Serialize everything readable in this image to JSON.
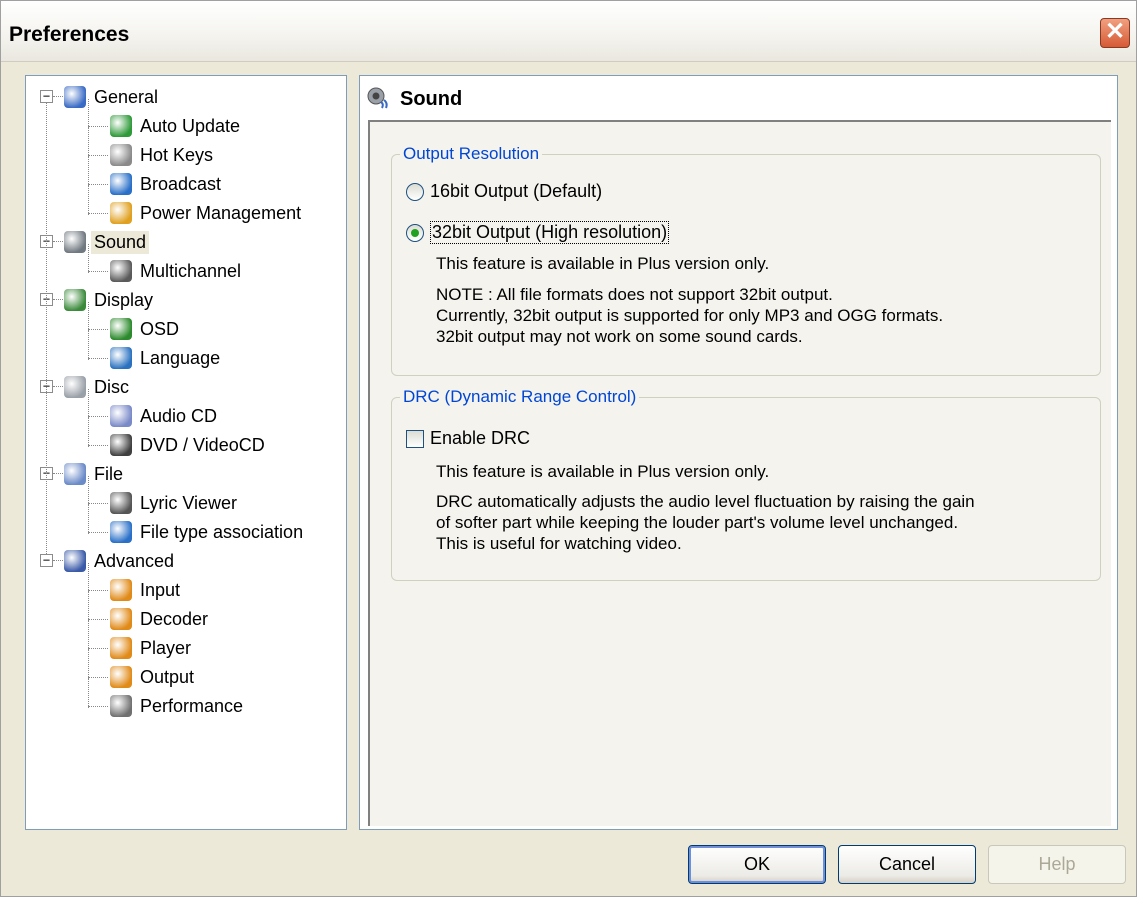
{
  "window": {
    "title": "Preferences",
    "close_label": "✕"
  },
  "tree": {
    "items": [
      {
        "label": "General",
        "level": 0,
        "expander": "−",
        "icon": "general-icon"
      },
      {
        "label": "Auto Update",
        "level": 1,
        "icon": "auto-update-icon"
      },
      {
        "label": "Hot Keys",
        "level": 1,
        "icon": "keyboard-icon"
      },
      {
        "label": "Broadcast",
        "level": 1,
        "icon": "broadcast-icon"
      },
      {
        "label": "Power Management",
        "level": 1,
        "icon": "power-icon"
      },
      {
        "label": "Sound",
        "level": 0,
        "expander": "−",
        "icon": "sound-icon",
        "selected": true
      },
      {
        "label": "Multichannel",
        "level": 1,
        "icon": "multichannel-icon"
      },
      {
        "label": "Display",
        "level": 0,
        "expander": "−",
        "icon": "display-icon"
      },
      {
        "label": "OSD",
        "level": 1,
        "icon": "osd-icon"
      },
      {
        "label": "Language",
        "level": 1,
        "icon": "globe-icon"
      },
      {
        "label": "Disc",
        "level": 0,
        "expander": "−",
        "icon": "disc-icon"
      },
      {
        "label": "Audio CD",
        "level": 1,
        "icon": "audio-cd-icon"
      },
      {
        "label": "DVD / VideoCD",
        "level": 1,
        "icon": "dvd-icon"
      },
      {
        "label": "File",
        "level": 0,
        "expander": "−",
        "icon": "file-icon"
      },
      {
        "label": "Lyric Viewer",
        "level": 1,
        "icon": "microphone-icon"
      },
      {
        "label": "File type association",
        "level": 1,
        "icon": "file-association-icon"
      },
      {
        "label": "Advanced",
        "level": 0,
        "expander": "−",
        "icon": "advanced-icon"
      },
      {
        "label": "Input",
        "level": 1,
        "icon": "cube-icon"
      },
      {
        "label": "Decoder",
        "level": 1,
        "icon": "cube-icon"
      },
      {
        "label": "Player",
        "level": 1,
        "icon": "cube-icon"
      },
      {
        "label": "Output",
        "level": 1,
        "icon": "cube-icon"
      },
      {
        "label": "Performance",
        "level": 1,
        "icon": "chip-icon"
      }
    ]
  },
  "panel": {
    "title": "Sound",
    "output_resolution": {
      "legend": "Output Resolution",
      "option_16": "16bit Output (Default)",
      "option_32": "32bit Output (High resolution)",
      "selected": "32bit",
      "note_plus": "This feature is available in Plus version only.",
      "note_1": "NOTE : All file formats does not support 32bit output.",
      "note_2": "Currently, 32bit output is supported for only MP3 and OGG formats.",
      "note_3": "32bit output may not work on some sound cards."
    },
    "drc": {
      "legend": "DRC (Dynamic Range Control)",
      "enable_label": "Enable DRC",
      "enabled": false,
      "note_plus": "This feature is available in Plus version only.",
      "desc_1": "DRC automatically adjusts the audio level fluctuation by raising the gain",
      "desc_2": "of softer part while keeping the louder part's volume level unchanged.",
      "desc_3": "This is useful for watching video."
    }
  },
  "buttons": {
    "ok": "OK",
    "cancel": "Cancel",
    "help": "Help"
  }
}
